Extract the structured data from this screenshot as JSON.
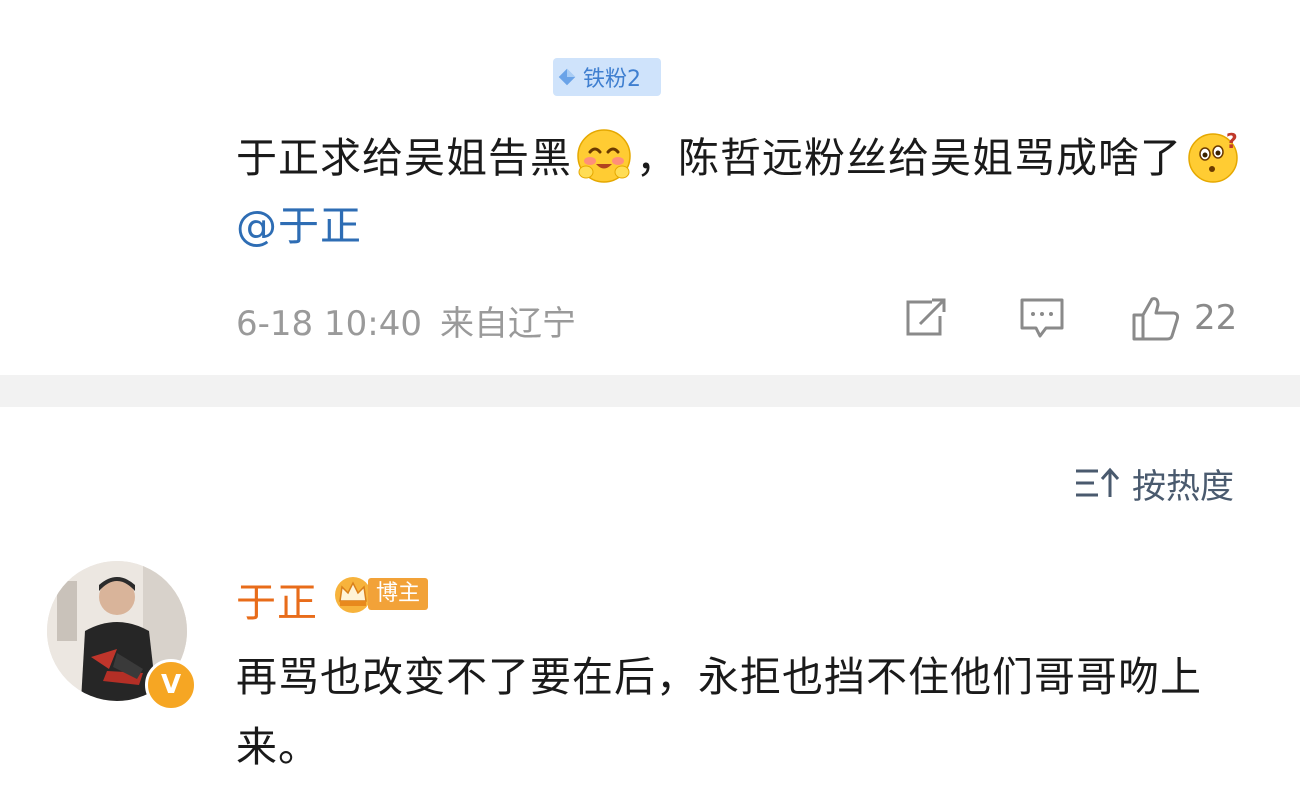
{
  "post": {
    "fan_badge": "铁粉2",
    "text_part1": "于正求给吴姐告黑",
    "text_part2": "，陈哲远粉丝给吴姐骂成啥了",
    "emoji1": "blush-emoji",
    "emoji2": "confused-emoji",
    "mention": "@于正",
    "date": "6-18 10:40",
    "location": "来自辽宁",
    "like_count": "22"
  },
  "comments_header": {
    "sort_label": "按热度"
  },
  "reply": {
    "username": "于正",
    "tag": "博主",
    "verified_mark": "V",
    "text": "再骂也改变不了要在后，永拒也挡不住他们哥哥吻上来。"
  },
  "colors": {
    "mention": "#2e6db4",
    "username": "#e86c1a",
    "badge_bg": "#cfe3fb",
    "divider": "#f2f2f2"
  }
}
